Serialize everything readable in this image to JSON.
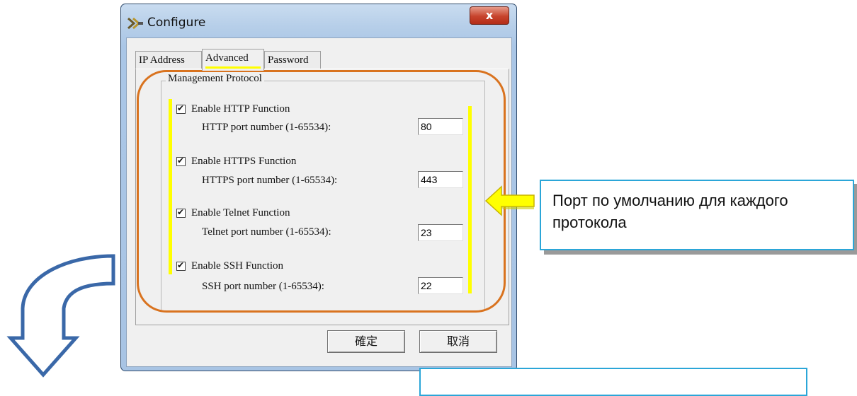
{
  "window": {
    "title": "Configure",
    "close_label": "x"
  },
  "tabs": [
    {
      "label": "IP Address",
      "active": false
    },
    {
      "label": "Advanced",
      "active": true
    },
    {
      "label": "Password",
      "active": false
    }
  ],
  "group": {
    "label": "Management Protocol"
  },
  "protocols": [
    {
      "check_label": "Enable HTTP Function",
      "checked": true,
      "port_label": "HTTP port number (1-65534):",
      "port_value": "80"
    },
    {
      "check_label": "Enable HTTPS Function",
      "checked": true,
      "port_label": "HTTPS port number (1-65534):",
      "port_value": "443"
    },
    {
      "check_label": "Enable Telnet Function",
      "checked": true,
      "port_label": "Telnet port number (1-65534):",
      "port_value": "23"
    },
    {
      "check_label": "Enable SSH Function",
      "checked": true,
      "port_label": "SSH port number (1-65534):",
      "port_value": "22"
    }
  ],
  "buttons": {
    "ok": "確定",
    "cancel": "取消"
  },
  "annotation": {
    "callout_text": "Порт по умолчанию для каждого протокола",
    "colors": {
      "highlight_box": "#d9731f",
      "highlight_bar": "#ffff00",
      "arrow": "#3a68a8",
      "callout_border": "#2ba6d8"
    }
  }
}
